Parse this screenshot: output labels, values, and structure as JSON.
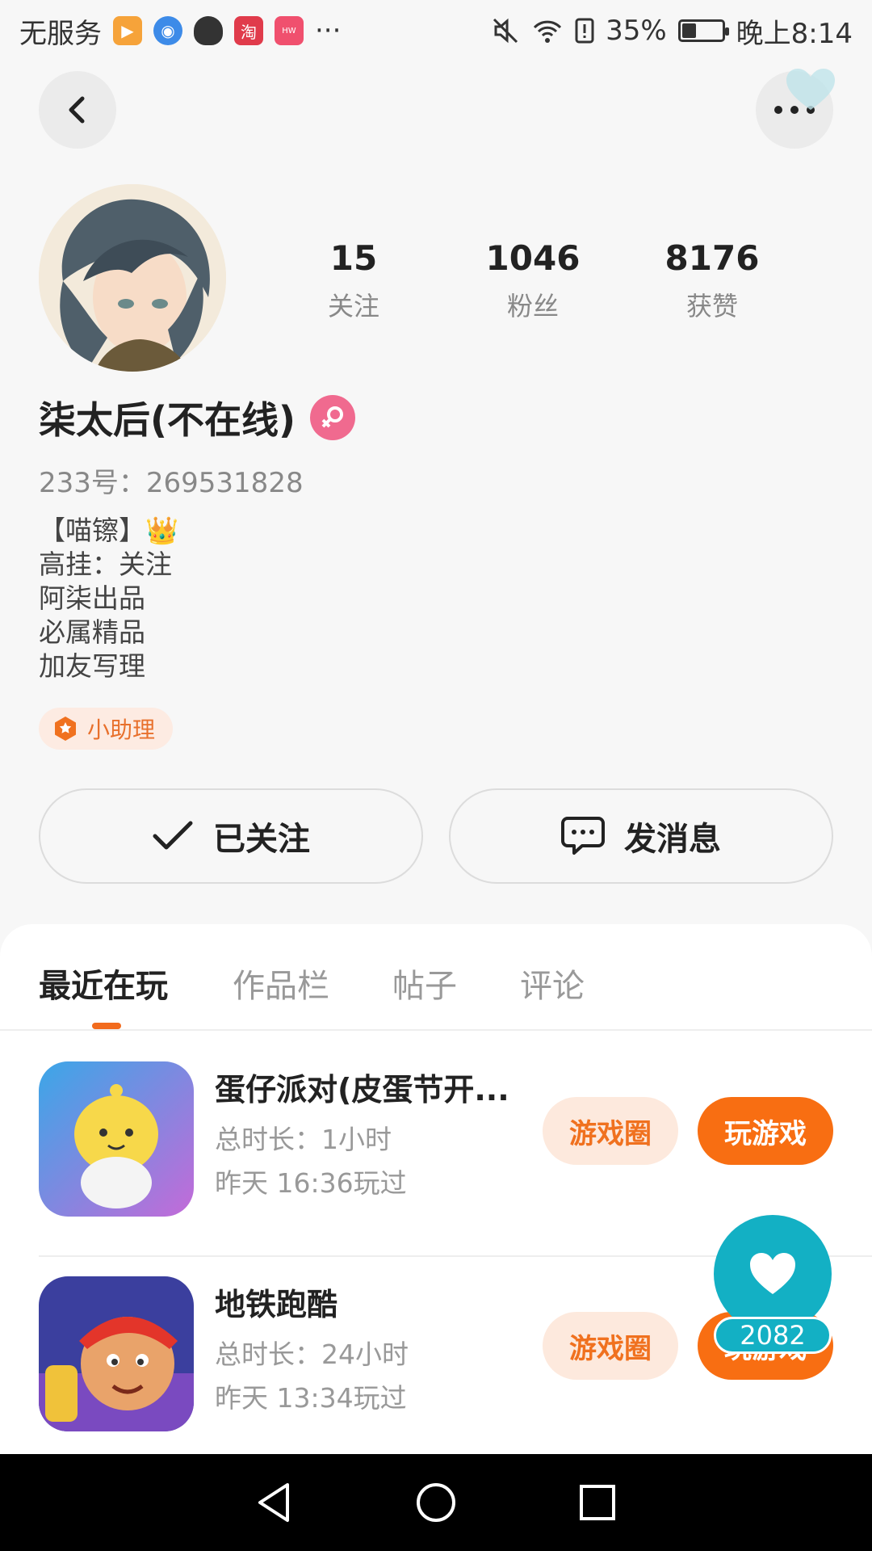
{
  "status_bar": {
    "carrier": "无服务",
    "more": "···",
    "battery_percent": "35%",
    "battery_level": 0.35,
    "time": "晚上8:14"
  },
  "header": {
    "back_icon": "chevron-left-icon",
    "more_icon": "more-horizontal-icon"
  },
  "profile": {
    "stats": [
      {
        "value": "15",
        "label": "关注"
      },
      {
        "value": "1046",
        "label": "粉丝"
      },
      {
        "value": "8176",
        "label": "获赞"
      }
    ],
    "name": "柒太后(不在线)",
    "gender": "female",
    "uid": "233号：269531828",
    "bio_lines": [
      "【喵镲】👑",
      "高挂：关注",
      "阿柒出品",
      "必属精品",
      "加友写理"
    ],
    "badge": "小助理"
  },
  "actions": {
    "follow_label": "已关注",
    "message_label": "发消息"
  },
  "tabs": [
    {
      "label": "最近在玩",
      "active": true
    },
    {
      "label": "作品栏",
      "active": false
    },
    {
      "label": "帖子",
      "active": false
    },
    {
      "label": "评论",
      "active": false
    }
  ],
  "games": [
    {
      "title": "蛋仔派对(皮蛋节开...",
      "duration": "总时长：1小时",
      "last_played": "昨天 16:36玩过",
      "circle_label": "游戏圈",
      "play_label": "玩游戏"
    },
    {
      "title": "地铁跑酷",
      "duration": "总时长：24小时",
      "last_played": "昨天 13:34玩过",
      "circle_label": "游戏圈",
      "play_label": "玩游戏"
    }
  ],
  "floating_like": {
    "count": "2082"
  },
  "colors": {
    "accent": "#f86e12",
    "like_button": "#13b0c4",
    "gender_badge": "#f06a8f"
  }
}
